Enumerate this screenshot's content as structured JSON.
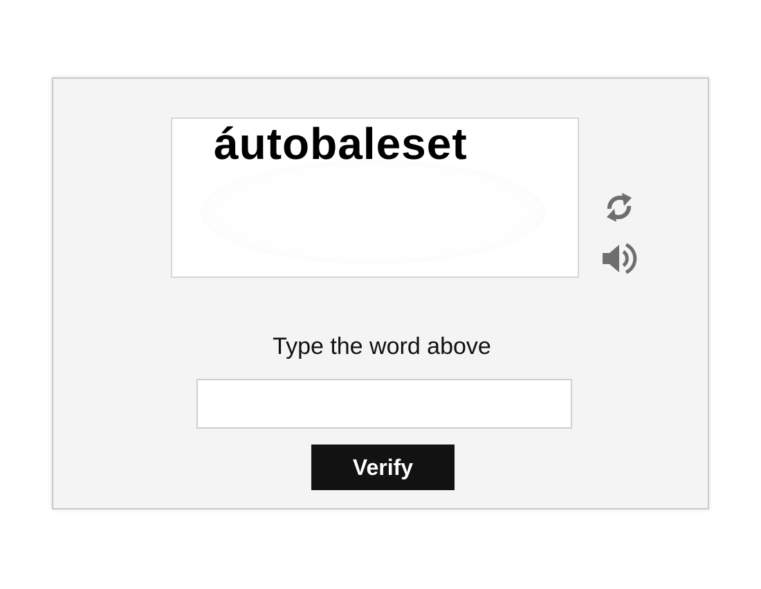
{
  "captcha": {
    "word": "áutobaleset",
    "prompt": "Type the word above",
    "refresh_icon": "refresh-icon",
    "audio_icon": "speaker-icon"
  },
  "answer": {
    "value": "",
    "placeholder": ""
  },
  "verify": {
    "label": "Verify"
  },
  "colors": {
    "panel_bg": "#f4f4f4",
    "button_bg": "#121212",
    "icon": "#6e6e6e"
  }
}
